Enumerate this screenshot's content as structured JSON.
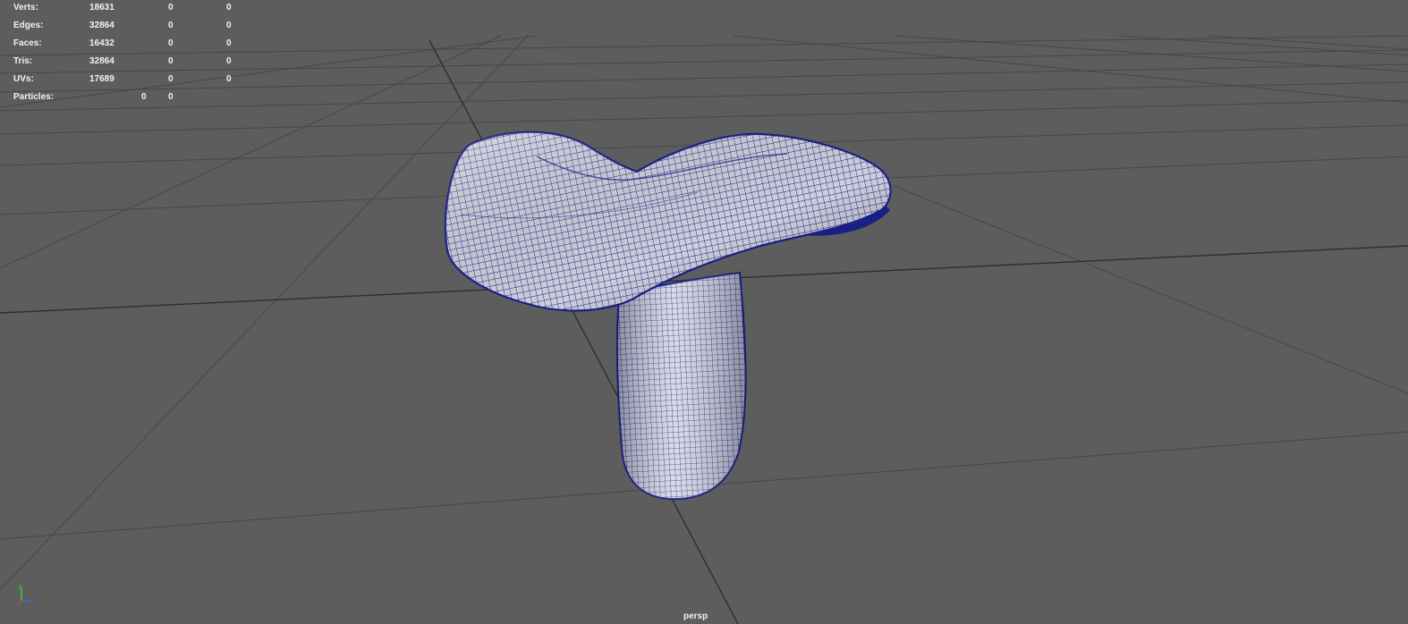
{
  "stats": [
    {
      "label": "Verts:",
      "values": [
        "18631",
        "0",
        "0"
      ]
    },
    {
      "label": "Edges:",
      "values": [
        "32864",
        "0",
        "0"
      ]
    },
    {
      "label": "Faces:",
      "values": [
        "16432",
        "0",
        "0"
      ]
    },
    {
      "label": "Tris:",
      "values": [
        "32864",
        "0",
        "0"
      ]
    },
    {
      "label": "UVs:",
      "values": [
        "17689",
        "0",
        "0"
      ]
    },
    {
      "label": "Particles:",
      "values": [
        "0",
        "0"
      ]
    }
  ],
  "camera": {
    "name": "persp"
  },
  "axis": {
    "y": "y",
    "z": "z"
  },
  "colors": {
    "background": "#5d5d5d",
    "grid": "#474747",
    "grid_axis": "#2f2f2f",
    "wire": "#1a1f86",
    "surface": "#c9c9d6",
    "hud_text": "#f2f2f2"
  }
}
